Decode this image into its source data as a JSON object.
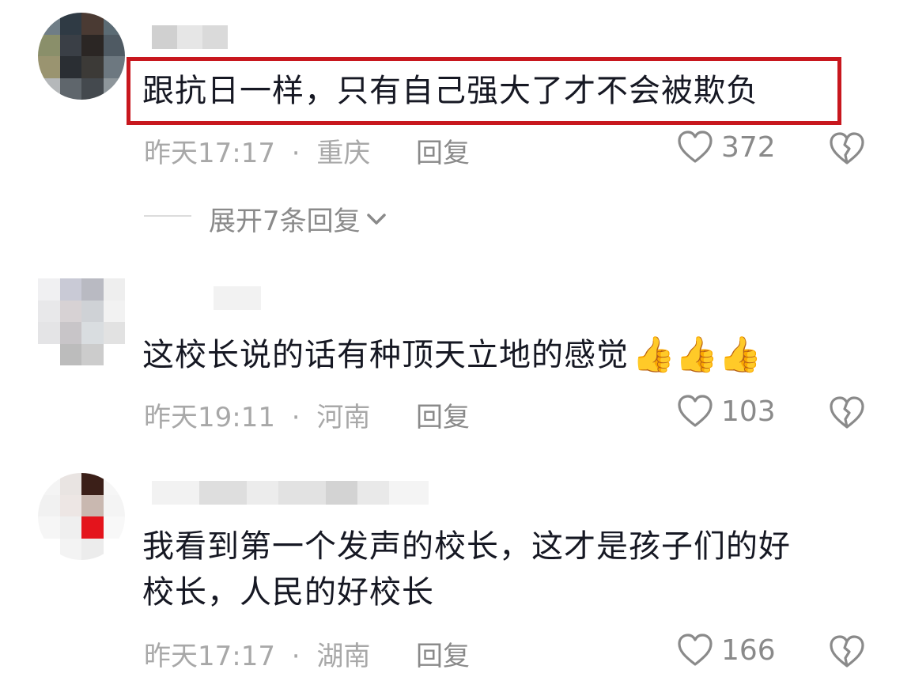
{
  "comments": [
    {
      "text": "跟抗日一样，只有自己强大了才不会被欺负",
      "time": "昨天17:17",
      "separator": "·",
      "location": "重庆",
      "reply_label": "回复",
      "likes": "372",
      "highlighted": true,
      "expand_replies": "展开7条回复"
    },
    {
      "text": "这校长说的话有种顶天立地的感觉",
      "emoji": "👍👍👍",
      "time": "昨天19:11",
      "separator": "·",
      "location": "河南",
      "reply_label": "回复",
      "likes": "103"
    },
    {
      "text_line1": "我看到第一个发声的校长，这才是孩子们的好",
      "text_line2": "校长，人民的好校长",
      "time": "昨天17:17",
      "separator": "·",
      "location": "湖南",
      "reply_label": "回复",
      "likes": "166"
    }
  ],
  "icons": {
    "like": "heart-outline-icon",
    "dislike": "broken-heart-icon",
    "expand": "chevron-down-icon"
  },
  "colors": {
    "highlight_border": "#c8171e",
    "text": "#161823",
    "meta": "#a8a8a8"
  }
}
